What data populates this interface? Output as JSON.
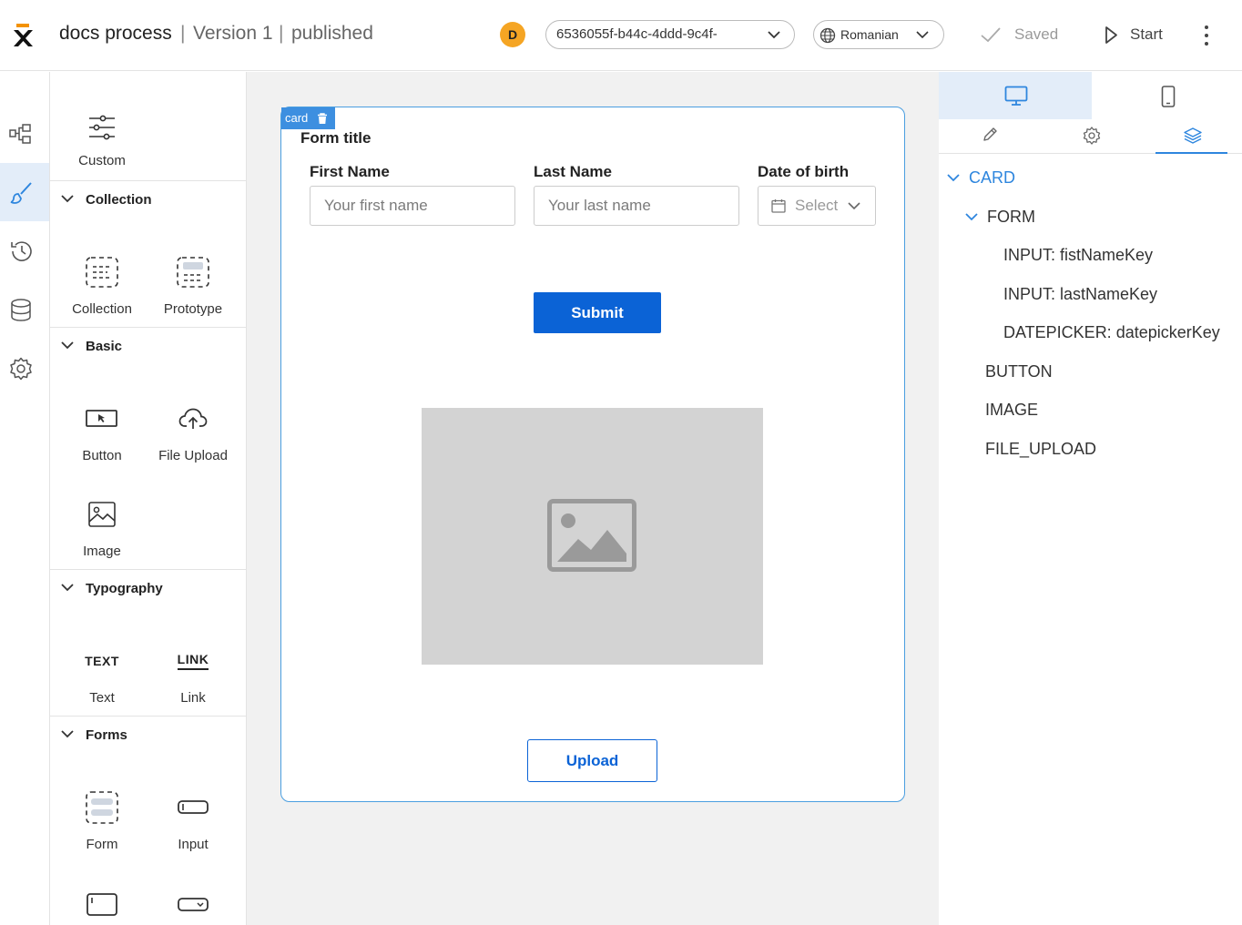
{
  "header": {
    "app_title": "docs process",
    "separator": "|",
    "version": "Version 1",
    "status": "published",
    "avatar_initial": "D",
    "id_select_value": "6536055f-b44c-4ddd-9c4f-",
    "language": "Romanian",
    "saved_label": "Saved",
    "start_label": "Start"
  },
  "rail": [
    "flow-icon",
    "brush-icon",
    "history-icon",
    "database-icon",
    "gear-icon"
  ],
  "components": {
    "custom": {
      "label": "Custom"
    },
    "sections": {
      "collection": {
        "title": "Collection",
        "items": [
          "Collection",
          "Prototype"
        ]
      },
      "basic": {
        "title": "Basic",
        "items": [
          "Button",
          "File Upload",
          "Image"
        ]
      },
      "typography": {
        "title": "Typography",
        "items": [
          "Text",
          "Link"
        ],
        "text_icon": "TEXT",
        "link_icon": "LINK"
      },
      "forms": {
        "title": "Forms",
        "items": [
          "Form",
          "Input"
        ]
      }
    }
  },
  "canvas": {
    "card_tag": "card",
    "form_title": "Form title",
    "fields": [
      {
        "label": "First Name",
        "placeholder": "Your first name"
      },
      {
        "label": "Last Name",
        "placeholder": "Your last name"
      },
      {
        "label": "Date of birth",
        "placeholder": "Select"
      }
    ],
    "submit_label": "Submit",
    "upload_label": "Upload"
  },
  "right_panel": {
    "tree": [
      "CARD",
      "FORM",
      "INPUT: fistNameKey",
      "INPUT: lastNameKey",
      "DATEPICKER: datepickerKey",
      "BUTTON",
      "IMAGE",
      "FILE_UPLOAD"
    ]
  },
  "colors": {
    "accent": "#0b63d6",
    "selection": "#3d8fe0",
    "avatar": "#f5a524",
    "tree_highlight": "#2e86de"
  }
}
